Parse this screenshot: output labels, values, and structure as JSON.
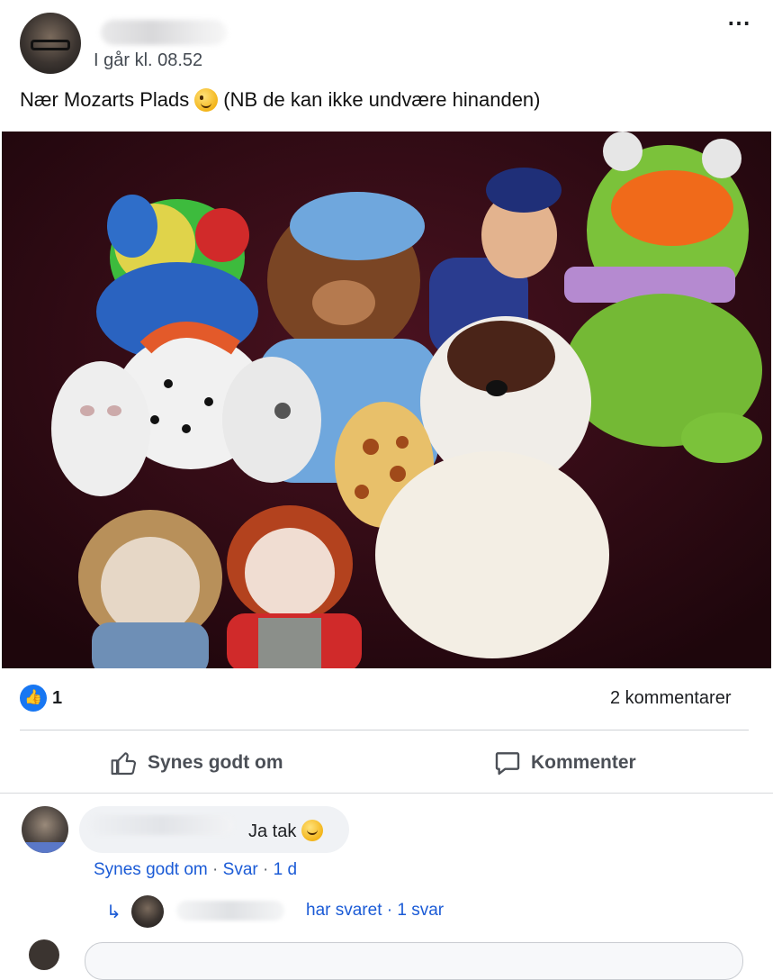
{
  "post": {
    "time": "I går kl. 08.52",
    "caption_before": "Nær Mozarts Plads",
    "caption_after": "(NB de kan ikke undvære hinanden)",
    "caption_emoji": "winking-face-emoji",
    "more_icon": "⋯",
    "photo": {
      "description_icon": "photo",
      "colors": {
        "background": "#2a0a12",
        "bear": "#7a4524",
        "bear_outfit": "#6fa7dd",
        "frog": "#7bc23a",
        "frog_mouth": "#f06a1a",
        "dog": "#f0ede8",
        "giraffe": "#e8c06a",
        "sheep": "#f3eee4",
        "doll_dress_red": "#d02a2a"
      }
    }
  },
  "reactions": {
    "like_icon": "👍",
    "like_count": "1",
    "comments_count": "2 kommentarer"
  },
  "actions": {
    "like_label": "Synes godt om",
    "comment_label": "Kommenter"
  },
  "comment": {
    "text": "Ja tak",
    "emoji": "smiling-face-emoji",
    "like": "Synes godt om",
    "reply": "Svar",
    "age": "1 d",
    "separator": "·"
  },
  "reply_thread": {
    "arrow": "↳",
    "text": "har svaret · 1 svar"
  },
  "colors": {
    "link_blue": "#1b5bd6",
    "facebook_blue": "#1877f2",
    "bubble": "#f0f2f5"
  }
}
